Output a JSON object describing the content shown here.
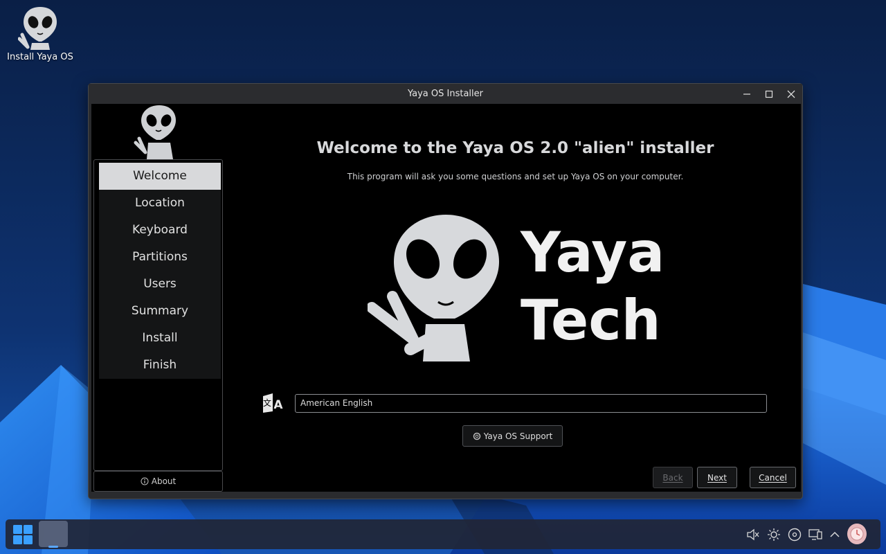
{
  "desktop": {
    "icon_label": "Install Yaya OS"
  },
  "window": {
    "title": "Yaya OS Installer"
  },
  "sidebar": {
    "items": [
      {
        "label": "Welcome",
        "active": true
      },
      {
        "label": "Location",
        "active": false
      },
      {
        "label": "Keyboard",
        "active": false
      },
      {
        "label": "Partitions",
        "active": false
      },
      {
        "label": "Users",
        "active": false
      },
      {
        "label": "Summary",
        "active": false
      },
      {
        "label": "Install",
        "active": false
      },
      {
        "label": "Finish",
        "active": false
      }
    ],
    "about_label": "About"
  },
  "main": {
    "title": "Welcome to the Yaya OS 2.0 \"alien\" installer",
    "subtitle": "This program will ask you some questions and set up Yaya OS on your computer.",
    "hero_line1": "Yaya",
    "hero_line2": "Tech",
    "language_value": "American English",
    "support_label": "Yaya OS Support"
  },
  "buttons": {
    "back": "Back",
    "next": "Next",
    "cancel": "Cancel"
  },
  "colors": {
    "accent": "#2f8ff0",
    "window_bg": "#000000",
    "nav_active": "#d8d9db"
  },
  "icons": [
    "alien-icon",
    "minimize-icon",
    "maximize-icon",
    "close-icon",
    "info-icon",
    "language-icon",
    "support-icon",
    "windows-start-icon",
    "mute-icon",
    "brightness-icon",
    "disc-icon",
    "display-icon",
    "chevron-up-icon",
    "user-avatar"
  ]
}
